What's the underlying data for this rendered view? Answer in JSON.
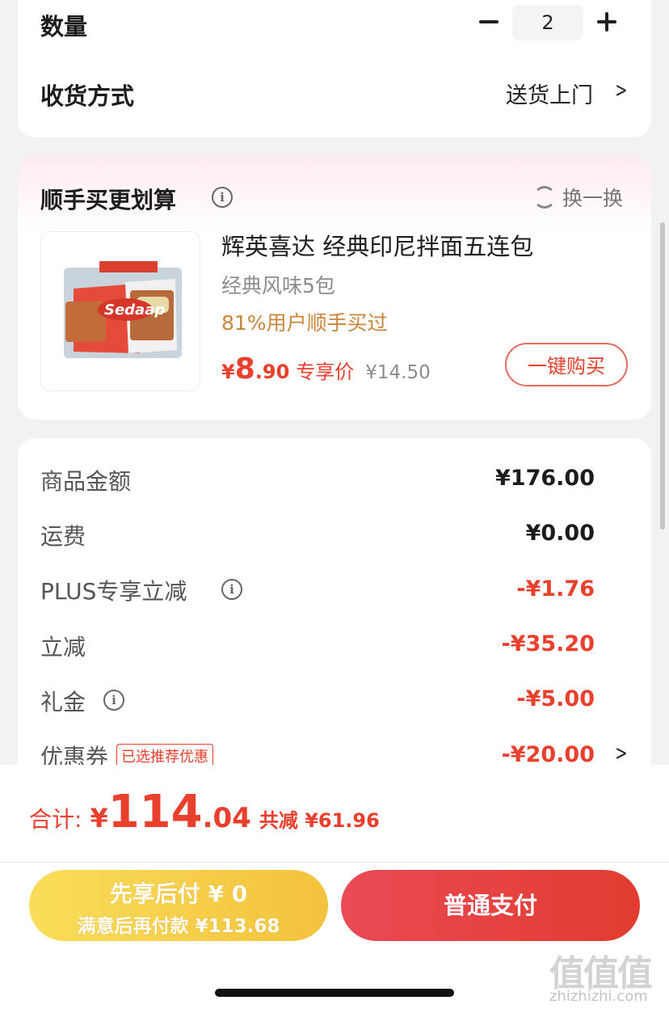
{
  "order": {
    "quantity_label": "数量",
    "quantity_value": "2",
    "delivery_label": "收货方式",
    "delivery_value": "送货上门"
  },
  "addon": {
    "title": "顺手买更划算",
    "swap_label": "换一换",
    "product": {
      "name": "辉英喜达 经典印尼拌面五连包",
      "spec": "经典风味5包",
      "bought": "81%用户顺手买过",
      "price_symbol": "¥",
      "price_int": "8",
      "price_dec": ".90",
      "price_tag": "专享价",
      "original_price": "¥14.50",
      "buy_label": "一键购买",
      "image_brand_text": "Sedaap"
    }
  },
  "summary": {
    "rows": [
      {
        "label": "商品金额",
        "value": "¥176.00"
      },
      {
        "label": "运费",
        "value": "¥0.00"
      },
      {
        "label": "PLUS专享立减",
        "value": "-¥1.76"
      },
      {
        "label": "立减",
        "value": "-¥35.20"
      },
      {
        "label": "礼金",
        "value": "-¥5.00"
      },
      {
        "label": "优惠券",
        "value": "-¥20.00",
        "tag": "已选推荐优惠"
      }
    ]
  },
  "footer": {
    "total_label": "合计:",
    "total_symbol": "¥",
    "total_int": "114",
    "total_dec": ".04",
    "total_save": "共减 ¥61.96",
    "bnpl_main": "先享后付 ¥ 0",
    "bnpl_sub": "满意后再付款 ¥113.68",
    "pay_label": "普通支付"
  },
  "watermark": {
    "mark": "值值值",
    "text": "zhizhizhi.com"
  },
  "colors": {
    "accent_red": "#e8402c",
    "bnpl_yellow": "#f3c23d",
    "pay_red": "#e23c30",
    "bought_orange": "#c9853a"
  },
  "icons": {
    "minus": "minus-icon",
    "plus": "plus-icon",
    "chevron": "chevron-right-icon",
    "info": "info-icon",
    "swap": "refresh-icon"
  }
}
